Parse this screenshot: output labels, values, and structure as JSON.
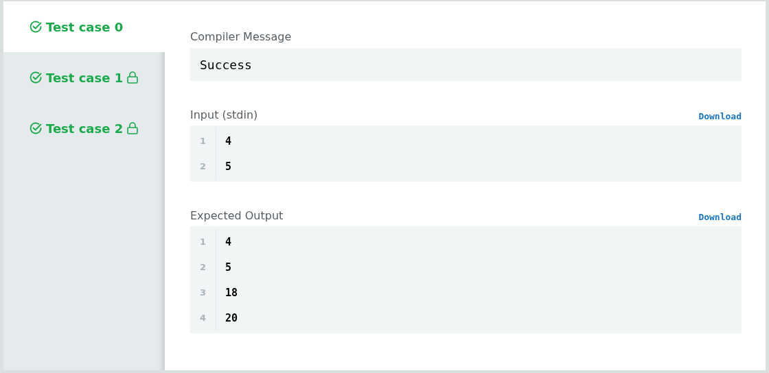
{
  "tabs": [
    {
      "label": "Test case 0",
      "selected": true,
      "passed": true,
      "locked": false
    },
    {
      "label": "Test case 1",
      "selected": false,
      "passed": true,
      "locked": true
    },
    {
      "label": "Test case 2",
      "selected": false,
      "passed": true,
      "locked": true
    }
  ],
  "compiler_message": {
    "title": "Compiler Message",
    "text": "Success"
  },
  "sections": [
    {
      "title": "Input (stdin)",
      "download": "Download",
      "lines": [
        {
          "number": "1",
          "text": "4"
        },
        {
          "number": "2",
          "text": "5"
        }
      ]
    },
    {
      "title": "Expected Output",
      "download": "Download",
      "lines": [
        {
          "number": "1",
          "text": "4"
        },
        {
          "number": "2",
          "text": "5"
        },
        {
          "number": "3",
          "text": "18"
        },
        {
          "number": "4",
          "text": "20"
        }
      ]
    }
  ]
}
